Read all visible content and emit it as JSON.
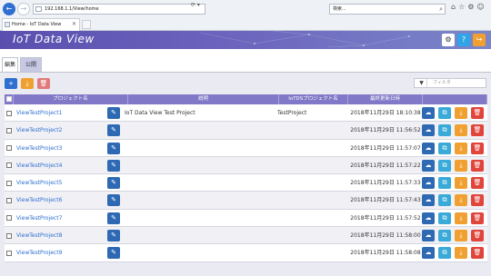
{
  "browser": {
    "address": "192.168.1.1/View/home",
    "search_placeholder": "検索...",
    "tab_title": "Home - IoT Data View",
    "back_icon": "arrow-left-icon",
    "forward_icon": "arrow-right-icon"
  },
  "app": {
    "title": "IoT Data View",
    "gear_icon": "⚙",
    "help_icon": "?",
    "logout_icon": "↪"
  },
  "tabs": [
    {
      "label": "編集",
      "active": true
    },
    {
      "label": "公開",
      "active": false
    }
  ],
  "toolbar": {
    "add_icon": "+",
    "download_icon": "⤓",
    "delete_icon": "🗑",
    "filter_icon": "▼",
    "filter_placeholder": "フィルタ"
  },
  "table": {
    "headers": {
      "name": "プロジェクト名",
      "desc": "説明",
      "iotds": "IoTDSプロジェクト名",
      "date": "最終更新日時"
    },
    "rows": [
      {
        "name": "ViewTestProject1",
        "desc": "IoT Data View Test Project",
        "iotds": "TestProject",
        "date": "2018年11月29日 18:10:38"
      },
      {
        "name": "ViewTestProject2",
        "desc": "",
        "iotds": "",
        "date": "2018年11月29日 11:56:52"
      },
      {
        "name": "ViewTestProject3",
        "desc": "",
        "iotds": "",
        "date": "2018年11月29日 11:57:07"
      },
      {
        "name": "ViewTestProject4",
        "desc": "",
        "iotds": "",
        "date": "2018年11月29日 11:57:22"
      },
      {
        "name": "ViewTestProject5",
        "desc": "",
        "iotds": "",
        "date": "2018年11月29日 11:57:33"
      },
      {
        "name": "ViewTestProject6",
        "desc": "",
        "iotds": "",
        "date": "2018年11月29日 11:57:43"
      },
      {
        "name": "ViewTestProject7",
        "desc": "",
        "iotds": "",
        "date": "2018年11月29日 11:57:52"
      },
      {
        "name": "ViewTestProject8",
        "desc": "",
        "iotds": "",
        "date": "2018年11月29日 11:58:00"
      },
      {
        "name": "ViewTestProject9",
        "desc": "",
        "iotds": "",
        "date": "2018年11月29日 11:58:08"
      }
    ],
    "row_icons": {
      "edit": "✎",
      "cloud": "☁",
      "copy": "⧉",
      "download": "⤓",
      "delete": "🗑"
    }
  },
  "colors": {
    "header_purple": "#6258b3",
    "table_header": "#8178c7",
    "primary_blue": "#2e69b3",
    "link_blue": "#2f6fd0",
    "orange": "#f0a030",
    "red": "#e0443a",
    "cyan": "#3aaad8"
  }
}
